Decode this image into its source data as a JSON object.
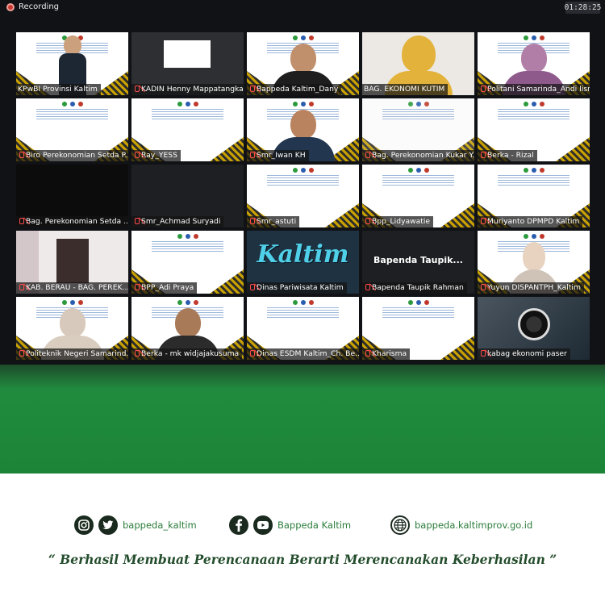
{
  "zoom": {
    "recording_label": "Recording",
    "timer": "01:28:25",
    "bapenda_screen_text": "Bapenda Taupik...",
    "kaltim_screen_text": "Kaltim",
    "tiles": [
      {
        "label": "KPwBI Provinsi Kaltim",
        "muted": false
      },
      {
        "label": "KADIN Henny Mappatangka",
        "muted": true
      },
      {
        "label": "Bappeda Kaltim_Dany",
        "muted": true
      },
      {
        "label": "BAG. EKONOMI KUTIM",
        "muted": false
      },
      {
        "label": "Politani Samarinda_Andi Iisna...",
        "muted": true
      },
      {
        "label": "Biro Perekonomian Setda P...",
        "muted": true
      },
      {
        "label": "Ray_YESS",
        "muted": true
      },
      {
        "label": "Smr_Iwan KH",
        "muted": true
      },
      {
        "label": "Bag. Perekonomian Kukar Y...",
        "muted": true
      },
      {
        "label": "Berka - Rizal",
        "muted": true
      },
      {
        "label": "Bag. Perekonomian Setda ...",
        "muted": true
      },
      {
        "label": "Smr_Achmad Suryadi",
        "muted": true
      },
      {
        "label": "Smr_astuti",
        "muted": true
      },
      {
        "label": "Bpp_Lidyawatie",
        "muted": true
      },
      {
        "label": "Muriyanto DPMPD Kaltim",
        "muted": true
      },
      {
        "label": "KAB. BERAU - BAG. PEREK...",
        "muted": true
      },
      {
        "label": "BPP_Adi Praya",
        "muted": true
      },
      {
        "label": "Dinas Pariwisata Kaltim",
        "muted": true
      },
      {
        "label": "Bapenda Taupik Rahman",
        "muted": true
      },
      {
        "label": "Yuyun DISPANTPH_Kaltim",
        "muted": true
      },
      {
        "label": "Politeknik Negeri Samarind...",
        "muted": true
      },
      {
        "label": "Berka - mk widjajakusuma",
        "muted": true
      },
      {
        "label": "Dinas ESDM Kaltim_Ch. Be...",
        "muted": true
      },
      {
        "label": "Kharisma",
        "muted": true
      },
      {
        "label": "kabag ekonomi paser",
        "muted": true
      }
    ]
  },
  "footer": {
    "instagram_twitter_handle": "bappeda_kaltim",
    "facebook_youtube_handle": "Bappeda Kaltim",
    "website": "bappeda.kaltimprov.go.id",
    "tagline": "“ Berhasil  Membuat Perencanaan Berarti Merencanakan Keberhasilan ”"
  },
  "colors": {
    "banner_green": "#1f8a3c",
    "footer_text_green": "#2a7c3a",
    "active_speaker_outline": "#7ed321"
  }
}
